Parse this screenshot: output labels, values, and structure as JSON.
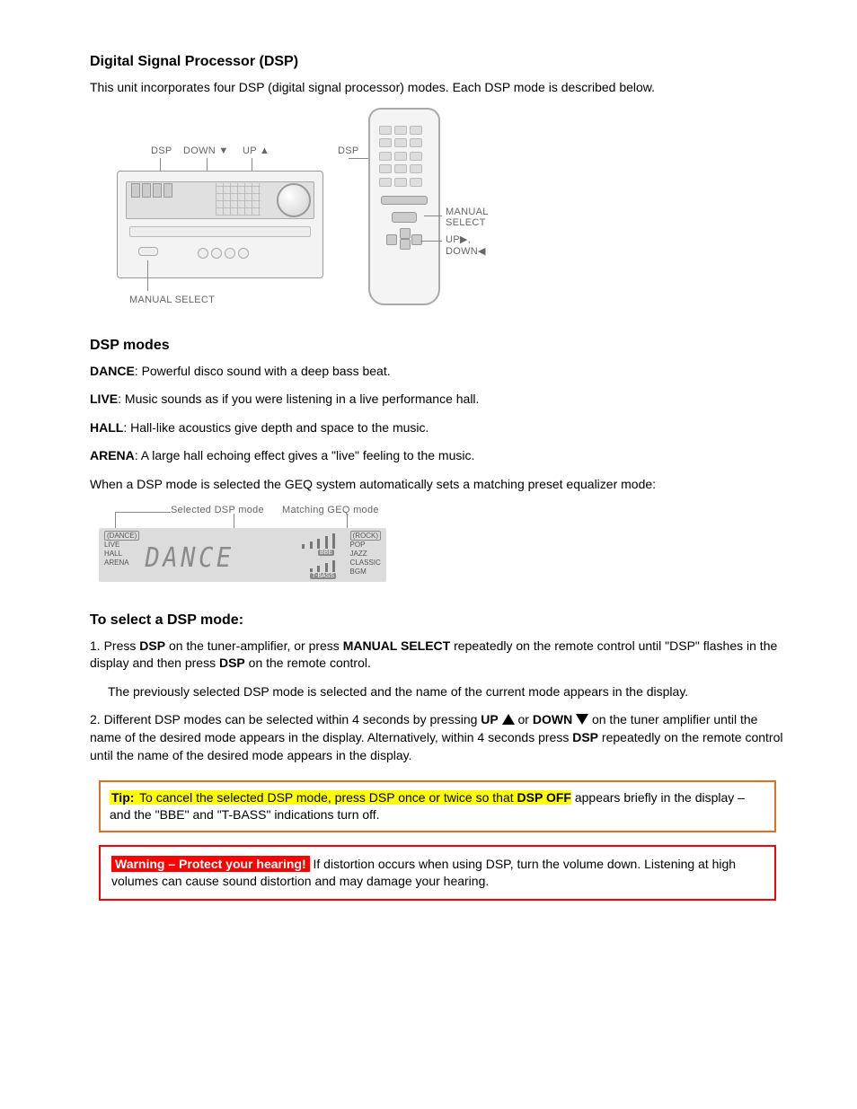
{
  "section": {
    "heading": "Digital Signal Processor (DSP)",
    "intro": "This unit incorporates four DSP (digital signal processor) modes. Each DSP mode is described below."
  },
  "figure1": {
    "labels": {
      "dsp_left": "DSP",
      "down": "DOWN ▼",
      "up": "UP ▲",
      "dsp_right": "DSP",
      "manual_select_right": "MANUAL\nSELECT",
      "up_down_right": "UP▶,\nDOWN◀",
      "manual_select_bottom": "MANUAL SELECT"
    }
  },
  "dsp_modes": {
    "title": "DSP modes",
    "items": [
      {
        "name": "DANCE",
        "desc": "Powerful disco sound with a deep bass beat."
      },
      {
        "name": "LIVE",
        "desc": "Music sounds as if you were listening in a live performance hall."
      },
      {
        "name": "HALL",
        "desc": "Hall-like acoustics give depth and space to the music."
      },
      {
        "name": "ARENA",
        "desc": "A large hall echoing effect gives a \"live\" feeling to the music."
      }
    ],
    "note_below": "When a DSP mode is selected the GEQ system automatically sets a matching preset equalizer mode:",
    "fig2": {
      "caption_left": "Selected DSP mode",
      "caption_right": "Matching GEQ mode",
      "left_list": [
        "(DANCE)",
        "LIVE",
        "HALL",
        "ARENA"
      ],
      "lcd": "DANCE",
      "right_list": [
        "(ROCK)",
        "POP",
        "JAZZ",
        "CLASSIC",
        "BGM"
      ],
      "tag_bbe": "BBE",
      "tag_tbass": "T-BASS"
    }
  },
  "select_mode": {
    "title": "To select a DSP mode:",
    "step1_a": "1. Press ",
    "step1_b": "DSP",
    "step1_c": " on the tuner-amplifier, or press ",
    "step1_d": "MANUAL SELECT",
    "step1_e": " repeatedly on the remote control until \"DSP\" flashes in the display and then press ",
    "step1_f": "DSP",
    "step1_g": " on the remote control.",
    "note1": "The previously selected DSP mode is selected and the name of the current mode appears in the display.",
    "step2_a": "2. Different DSP modes can be selected within 4 seconds by pressing ",
    "step2_b": "UP",
    "step2_c": " or ",
    "step2_d": "DOWN",
    "step2_e": " on the tuner amplifier until the name of the desired mode appears in the display. Alternatively, within 4 seconds press ",
    "step2_f": "DSP",
    "step2_g": " repeatedly on the remote control until the name of the desired mode appears in the display."
  },
  "tip": {
    "label": "Tip:",
    "line1": " To cancel the selected DSP mode, press DSP once or twice so that ",
    "off": "DSP OFF",
    "line2": "appears briefly in the display – and the \"BBE\" and \"T-BASS\" indications turn off."
  },
  "warning": {
    "label": "Warning – Protect your hearing!",
    "text": " If distortion occurs when using DSP, turn the volume down. Listening at high volumes can cause sound distortion and may damage your hearing."
  }
}
